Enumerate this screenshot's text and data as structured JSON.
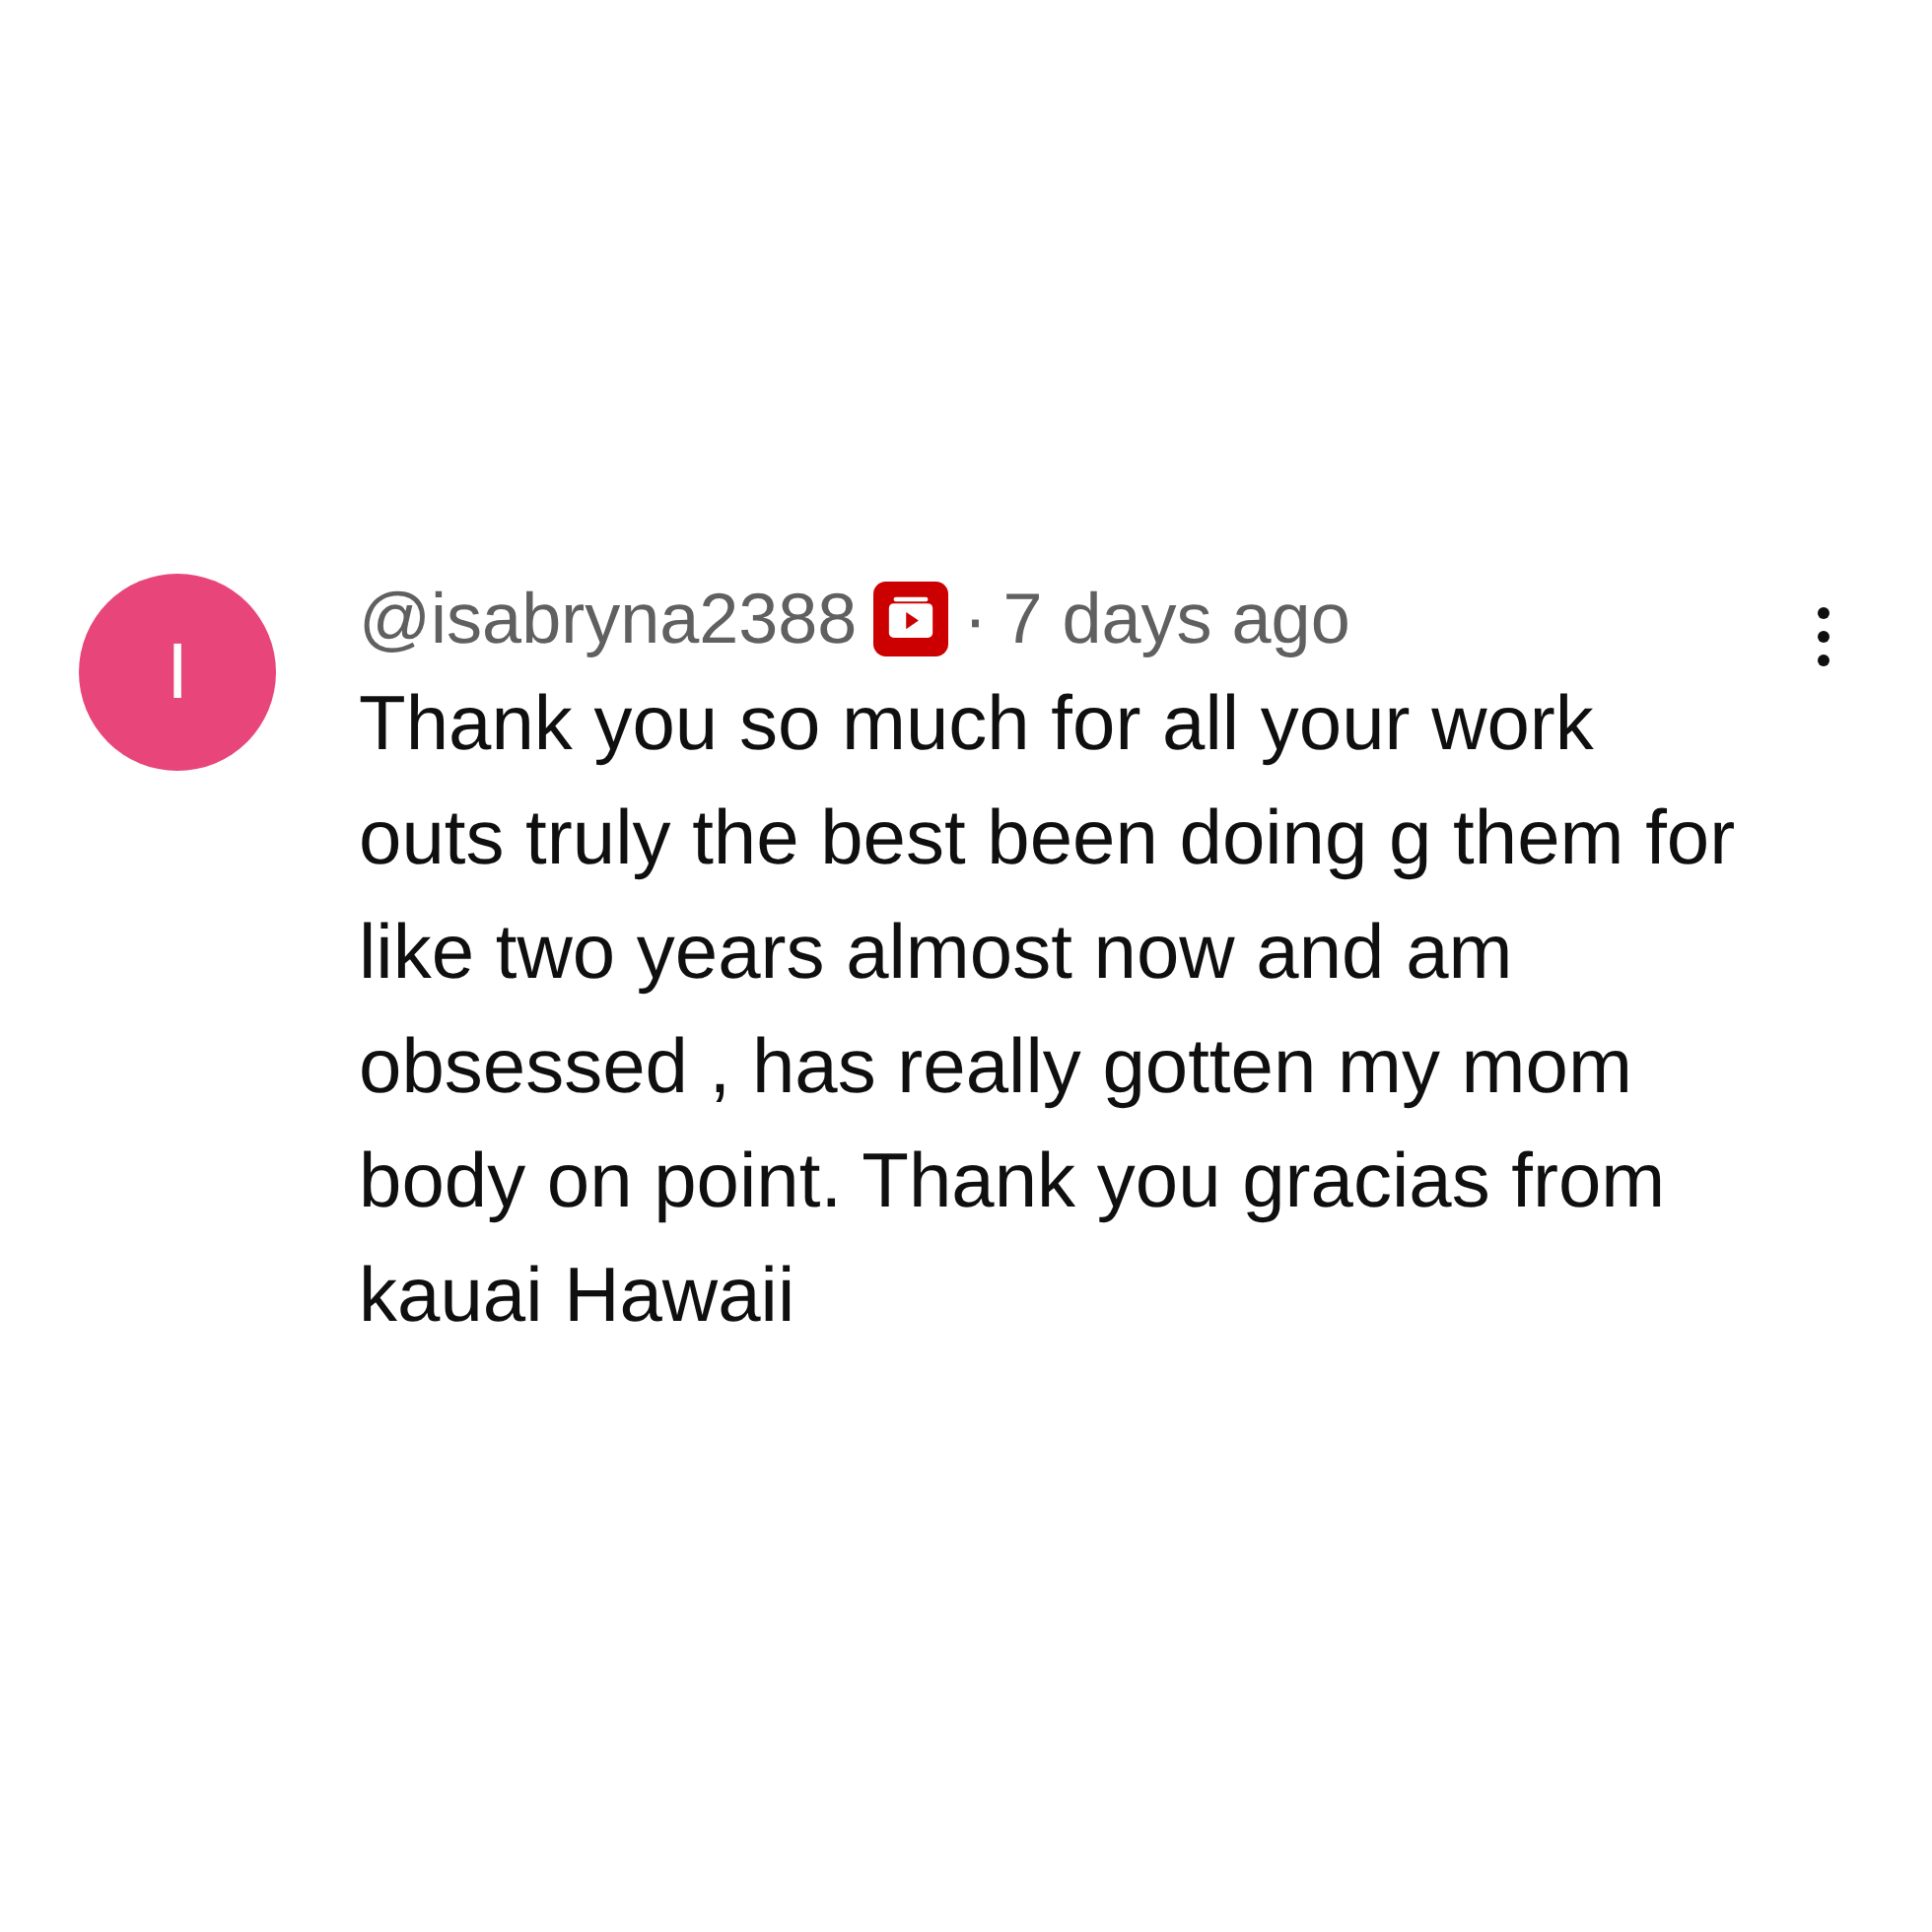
{
  "comment": {
    "avatar_letter": "I",
    "author": "@isabryna2388",
    "separator": "·",
    "time": "7 days ago",
    "text": "Thank you so much for all your work outs truly the best been doing g them for like two years almost now and am obsessed , has really gotten my mom body on point. Thank you gracias from kauai Hawaii"
  }
}
